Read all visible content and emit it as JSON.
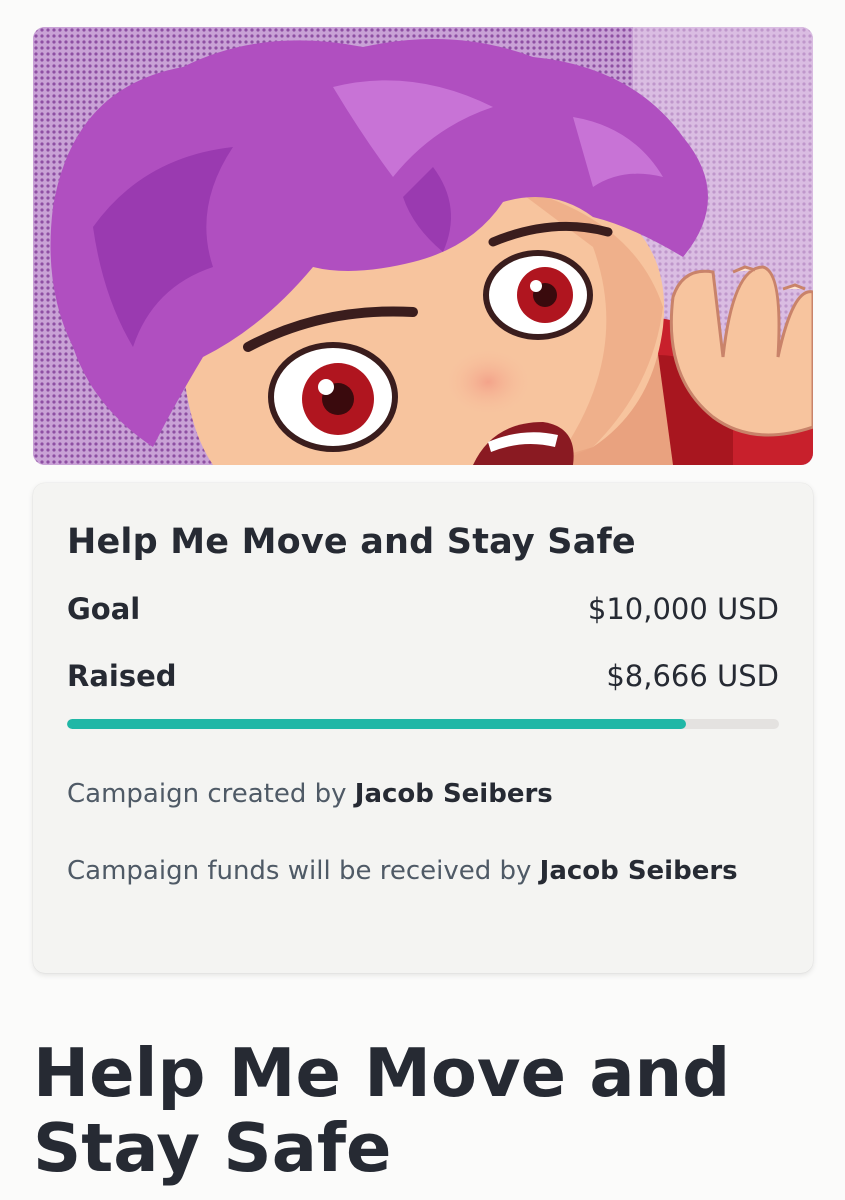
{
  "campaign": {
    "title": "Help Me Move and Stay Safe",
    "goal_label": "Goal",
    "goal_value": "$10,000 USD",
    "raised_label": "Raised",
    "raised_value": "$8,666 USD",
    "progress_percent": 87,
    "created_by_prefix": "Campaign created by",
    "created_by_name": "Jacob Seibers",
    "funds_prefix": "Campaign funds will be received by",
    "funds_name": "Jacob Seibers"
  },
  "page": {
    "heading": "Help Me Move and Stay Safe"
  },
  "colors": {
    "progress_fill": "#20b7a6",
    "progress_track": "#e4e2e0",
    "card_background": "#f4f4f2",
    "text_primary": "#262a33",
    "text_secondary": "#4f5a66"
  },
  "hero_image": {
    "icon": "campaign-cover-illustration"
  }
}
